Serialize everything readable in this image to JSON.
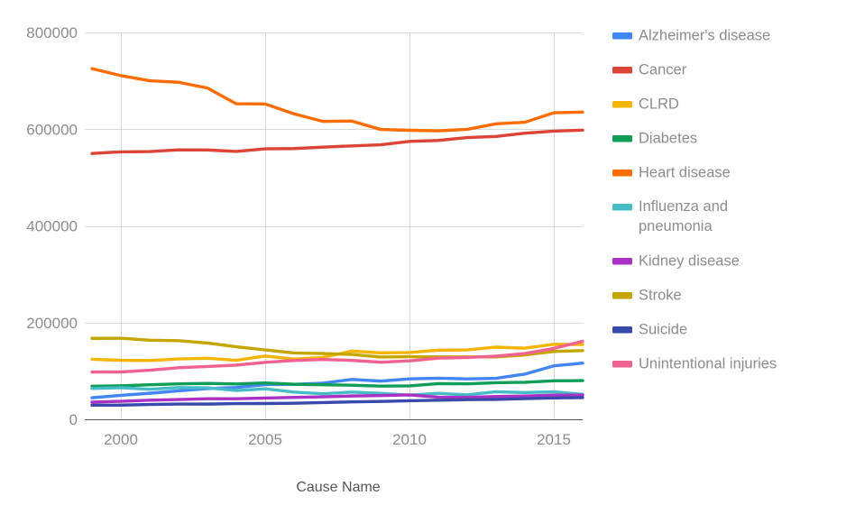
{
  "chart_data": {
    "type": "line",
    "title": "",
    "xlabel": "Cause Name",
    "ylabel": "",
    "x": [
      1999,
      2000,
      2001,
      2002,
      2003,
      2004,
      2005,
      2006,
      2007,
      2008,
      2009,
      2010,
      2011,
      2012,
      2013,
      2014,
      2015,
      2016
    ],
    "x_tick_labels": [
      "2000",
      "2005",
      "2010",
      "2015"
    ],
    "x_ticks": [
      2000,
      2005,
      2010,
      2015
    ],
    "xlim": [
      1999,
      2016
    ],
    "y_tick_labels": [
      "0",
      "200000",
      "400000",
      "600000",
      "800000"
    ],
    "y_ticks": [
      0,
      200000,
      400000,
      600000,
      800000
    ],
    "ylim": [
      0,
      800000
    ],
    "grid": true,
    "legend_position": "right",
    "series": [
      {
        "name": "Alzheimer's disease",
        "color": "#4285f4",
        "values": [
          44536,
          49558,
          53852,
          58866,
          63457,
          65829,
          71599,
          72432,
          74632,
          82435,
          79003,
          83494,
          84974,
          83637,
          84767,
          93541,
          110561,
          116103
        ]
      },
      {
        "name": "Cancer",
        "color": "#db4437",
        "values": [
          549838,
          553091,
          553768,
          557271,
          556902,
          553888,
          559312,
          559888,
          562875,
          565469,
          567628,
          574743,
          576691,
          582623,
          584881,
          591699,
          595930,
          598038
        ]
      },
      {
        "name": "CLRD",
        "color": "#f4b400",
        "values": [
          124181,
          122009,
          121514,
          124816,
          126128,
          121987,
          130933,
          124583,
          127924,
          141090,
          137353,
          138080,
          142943,
          143489,
          149205,
          147101,
          155041,
          154596
        ]
      },
      {
        "name": "Diabetes",
        "color": "#0f9d58",
        "values": [
          68399,
          69301,
          71372,
          73249,
          74219,
          73138,
          75119,
          72507,
          71382,
          70553,
          68705,
          69071,
          73831,
          73282,
          75578,
          76488,
          79535,
          80058
        ]
      },
      {
        "name": "Heart disease",
        "color": "#ff6d00",
        "values": [
          725192,
          710760,
          700142,
          696947,
          685089,
          652486,
          652091,
          631636,
          616067,
          616828,
          599413,
          597689,
          596577,
          599711,
          611105,
          614348,
          633842,
          635260
        ]
      },
      {
        "name": "Influenza and pneumonia",
        "color": "#46bdc6",
        "values": [
          63730,
          65313,
          62034,
          65681,
          65163,
          59664,
          63001,
          56326,
          52717,
          56284,
          53692,
          50097,
          53667,
          50622,
          56979,
          55227,
          57062,
          51537
        ]
      },
      {
        "name": "Kidney disease",
        "color": "#ab30c4",
        "values": [
          35525,
          37251,
          39480,
          40974,
          42514,
          42480,
          43901,
          45344,
          46448,
          48237,
          49042,
          50476,
          45731,
          45591,
          47112,
          48146,
          49959,
          50046
        ]
      },
      {
        "name": "Stroke",
        "color": "#c5a600",
        "values": [
          167366,
          167661,
          163538,
          162672,
          157689,
          150074,
          143579,
          137265,
          135952,
          134148,
          128842,
          129476,
          128932,
          128932,
          128978,
          133103,
          140323,
          142142
        ]
      },
      {
        "name": "Suicide",
        "color": "#3949ab",
        "values": [
          29199,
          29350,
          30622,
          31655,
          31484,
          32439,
          32637,
          33300,
          34598,
          36035,
          36909,
          38364,
          39518,
          40600,
          41149,
          42773,
          44193,
          44965
        ]
      },
      {
        "name": "Unintentional injuries",
        "color": "#f06292",
        "values": [
          97860,
          97900,
          101537,
          106742,
          109277,
          112012,
          117809,
          121599,
          123706,
          121902,
          118021,
          120859,
          126438,
          127792,
          130557,
          136053,
          146571,
          161374
        ]
      }
    ]
  },
  "axes": {
    "x_title": "Cause Name"
  },
  "legend": {
    "items": [
      {
        "label": "Alzheimer's disease",
        "color": "#4285f4"
      },
      {
        "label": "Cancer",
        "color": "#db4437"
      },
      {
        "label": "CLRD",
        "color": "#f4b400"
      },
      {
        "label": "Diabetes",
        "color": "#0f9d58"
      },
      {
        "label": "Heart disease",
        "color": "#ff6d00"
      },
      {
        "label": "Influenza and pneumonia",
        "color": "#46bdc6"
      },
      {
        "label": "Kidney disease",
        "color": "#ab30c4"
      },
      {
        "label": "Stroke",
        "color": "#c5a600"
      },
      {
        "label": "Suicide",
        "color": "#3949ab"
      },
      {
        "label": "Unintentional injuries",
        "color": "#f06292"
      }
    ]
  }
}
